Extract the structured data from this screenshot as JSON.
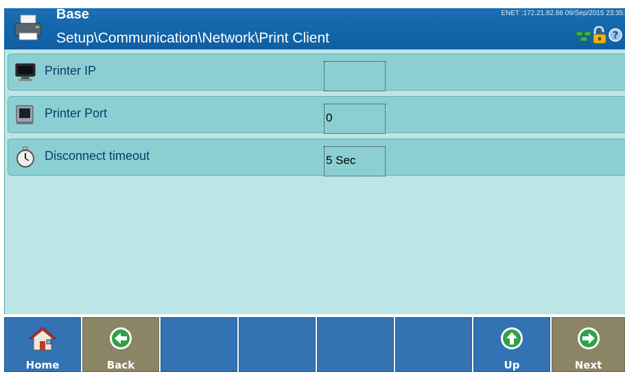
{
  "header": {
    "app_title": "Base",
    "breadcrumb": "Setup\\Communication\\Network\\Print Client",
    "status_text": "ENET :172.21.82.86  09/Sep/2015 23:35:"
  },
  "rows": [
    {
      "label": "Printer IP",
      "value": ""
    },
    {
      "label": "Printer Port",
      "value": "0"
    },
    {
      "label": "Disconnect timeout",
      "value": "5 Sec"
    }
  ],
  "softkeys": {
    "home": "Home",
    "back": "Back",
    "up": "Up",
    "next": "Next"
  },
  "colors": {
    "header_blue": "#0e5ea1",
    "content_bg": "#bde5e6",
    "row_bg": "#8ccfd3",
    "key_blue": "#3372b3",
    "key_tan": "#8b8465",
    "icon_green": "#33a04a"
  }
}
